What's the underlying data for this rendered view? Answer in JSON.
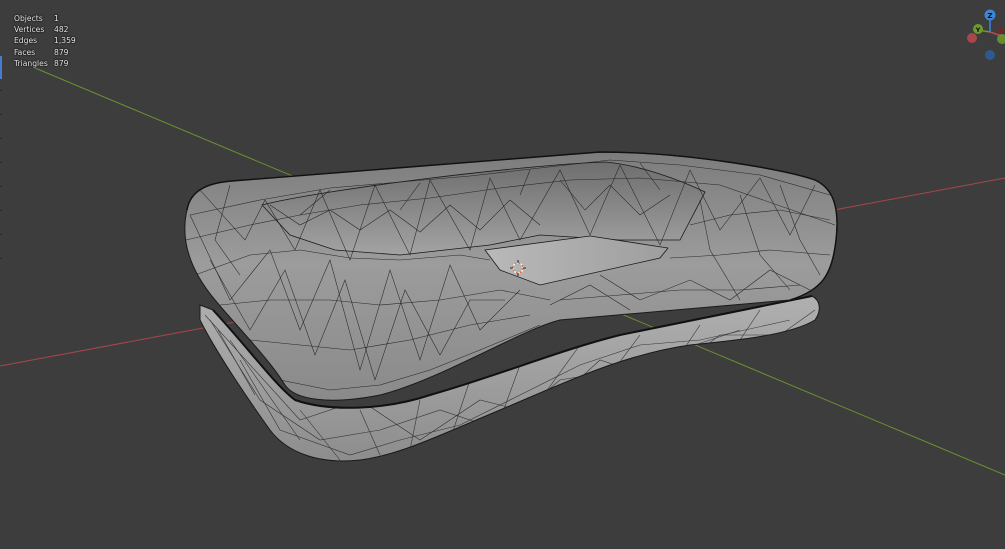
{
  "stats": [
    {
      "label": "Objects",
      "value": "1"
    },
    {
      "label": "Vertices",
      "value": "482"
    },
    {
      "label": "Edges",
      "value": "1,359"
    },
    {
      "label": "Faces",
      "value": "879"
    },
    {
      "label": "Triangles",
      "value": "879"
    }
  ],
  "gizmo": {
    "z_label": "Z",
    "y_label": "Y"
  },
  "colors": {
    "background": "#3d3d3d",
    "x_axis": "#b5484d",
    "y_axis": "#6f9a2f",
    "z_axis": "#3b86d6",
    "mesh_fill": "#8a8a8a",
    "wire": "#1a1a1a",
    "accent": "#4a7bd1"
  }
}
